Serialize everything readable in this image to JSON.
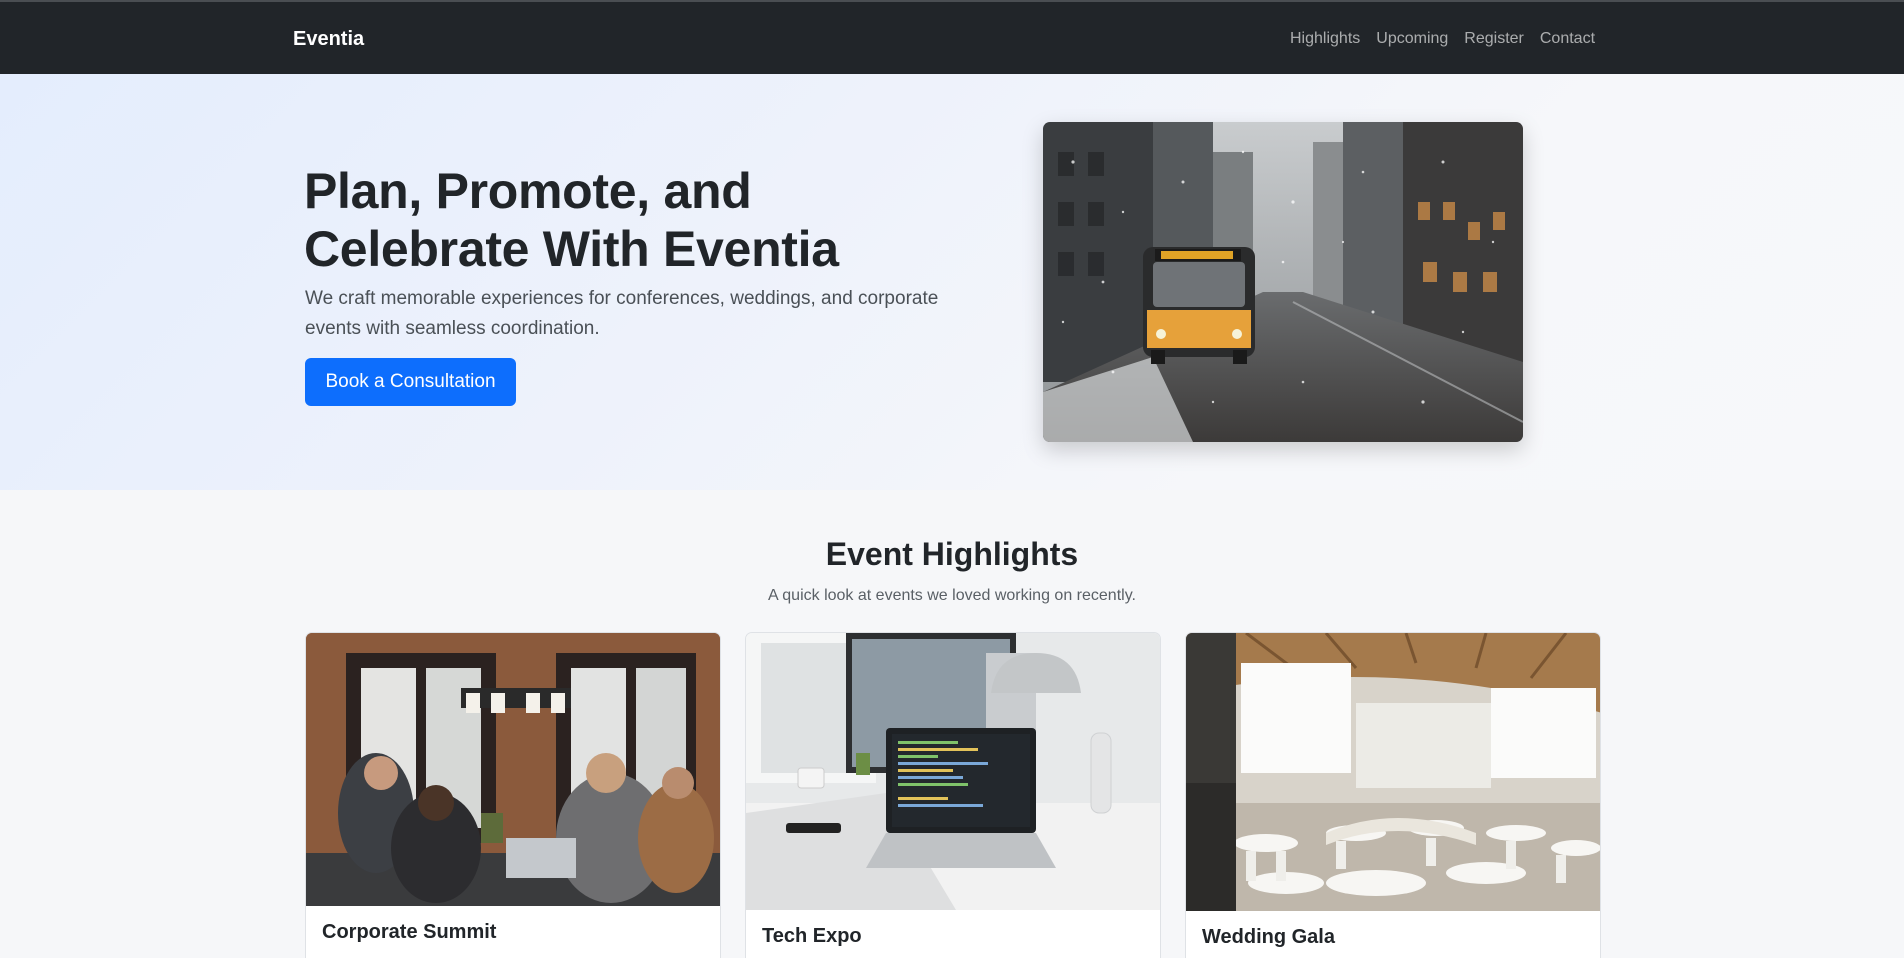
{
  "navbar": {
    "brand": "Eventia",
    "links": [
      "Highlights",
      "Upcoming",
      "Register",
      "Contact"
    ]
  },
  "hero": {
    "title": "Plan, Promote, and Celebrate With Eventia",
    "lead": "We craft memorable experiences for conferences, weddings, and corporate events with seamless coordination.",
    "cta_label": "Book a Consultation",
    "image_icon": "snowy-city-street-bus-photo"
  },
  "highlights": {
    "title": "Event Highlights",
    "subtitle": "A quick look at events we loved working on recently.",
    "cards": [
      {
        "title": "Corporate Summit",
        "image_icon": "team-meeting-photo"
      },
      {
        "title": "Tech Expo",
        "image_icon": "laptop-desk-photo"
      },
      {
        "title": "Wedding Gala",
        "image_icon": "banquet-hall-photo"
      }
    ]
  },
  "colors": {
    "navbar_bg": "#212529",
    "primary": "#0d6efd",
    "page_bg": "#f6f7f9"
  }
}
